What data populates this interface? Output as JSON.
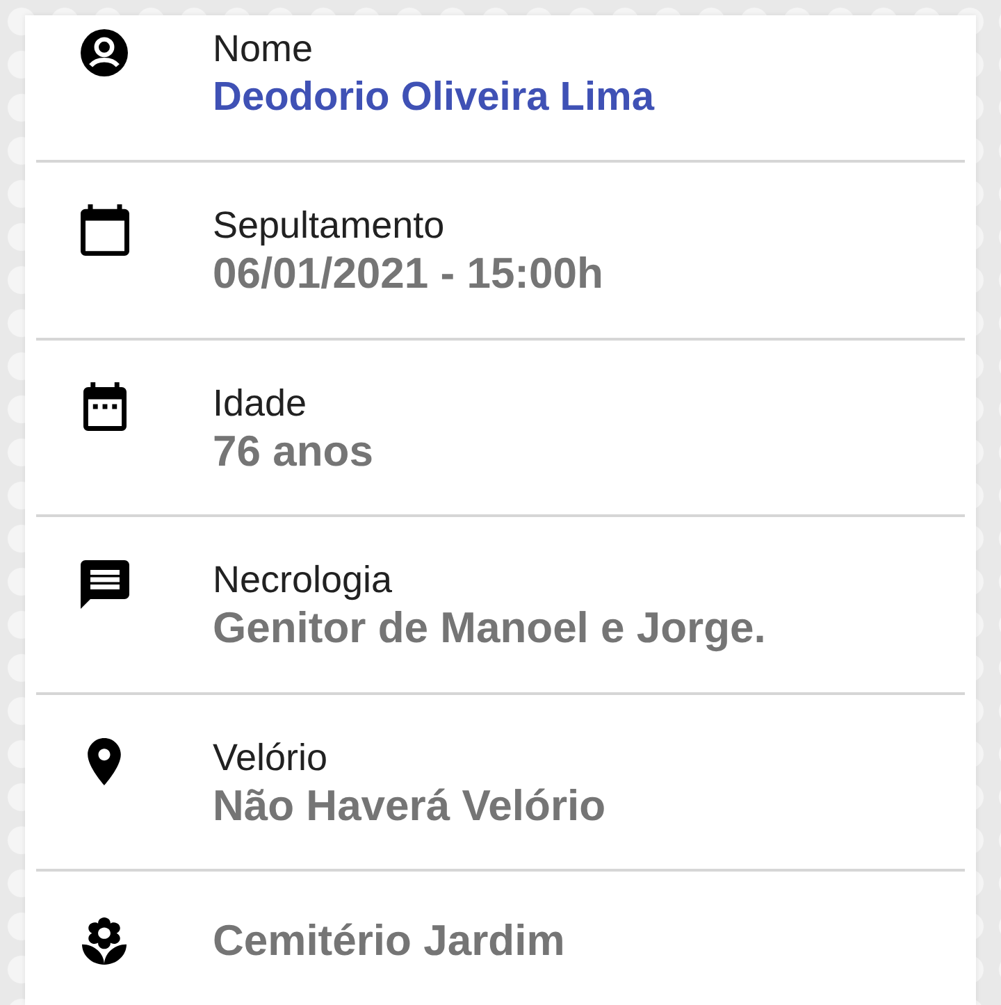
{
  "name_field": {
    "label": "Nome",
    "value": "Deodorio Oliveira Lima"
  },
  "details": [
    {
      "kind": "burial",
      "label": "Sepultamento",
      "value": "06/01/2021 - 15:00h"
    },
    {
      "kind": "age",
      "label": "Idade",
      "value": "76 anos"
    },
    {
      "kind": "obituary",
      "label": "Necrologia",
      "value": "Genitor de Manoel e Jorge."
    },
    {
      "kind": "wake",
      "label": "Velório",
      "value": "Não Haverá Velório"
    },
    {
      "kind": "cemetery",
      "value": "Cemitério Jardim"
    }
  ]
}
